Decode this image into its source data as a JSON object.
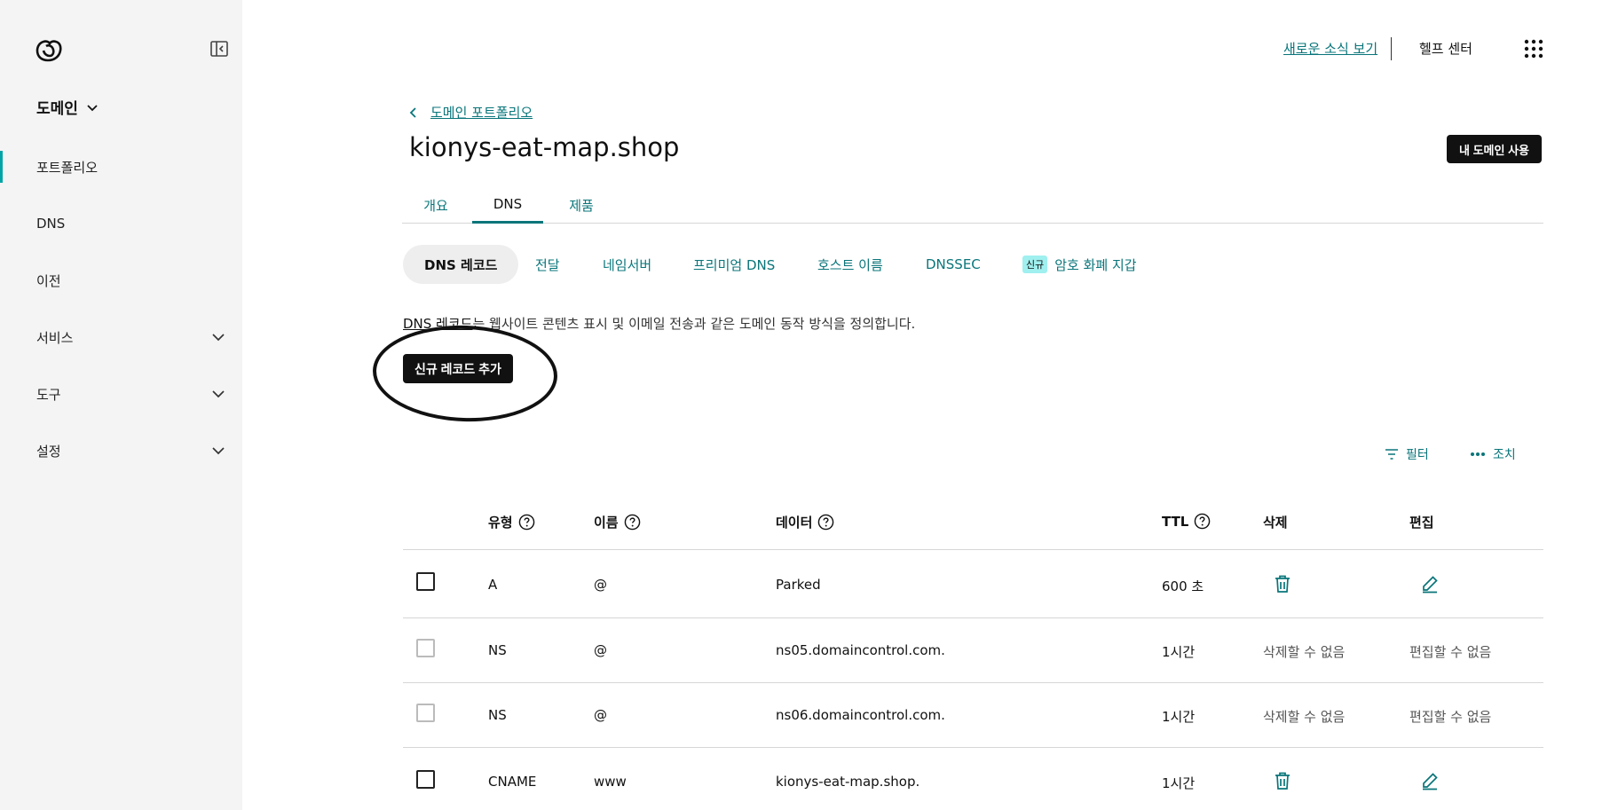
{
  "sidebar": {
    "domain_menu": "도메인",
    "items": [
      {
        "label": "포트폴리오"
      },
      {
        "label": "DNS"
      },
      {
        "label": "이전"
      },
      {
        "label": "서비스"
      },
      {
        "label": "도구"
      },
      {
        "label": "설정"
      }
    ]
  },
  "topbar": {
    "news_link": "새로운 소식 보기",
    "help_center": "헬프 센터"
  },
  "header": {
    "back_label": "도메인 포트폴리오",
    "title": "kionys-eat-map.shop",
    "use_domain_button": "내 도메인 사용"
  },
  "tabs": [
    {
      "label": "개요"
    },
    {
      "label": "DNS"
    },
    {
      "label": "제품"
    }
  ],
  "subtabs": [
    {
      "label": "DNS 레코드"
    },
    {
      "label": "전달"
    },
    {
      "label": "네임서버"
    },
    {
      "label": "프리미엄 DNS"
    },
    {
      "label": "호스트 이름"
    },
    {
      "label": "DNSSEC"
    },
    {
      "badge": "신규",
      "label": "암호 화폐 지갑"
    }
  ],
  "description": {
    "link": "DNS 레코드",
    "text": "는 웹사이트 콘텐츠 표시 및 이메일 전송과 같은 도메인 동작 방식을 정의합니다."
  },
  "add_record_button": "신규 레코드 추가",
  "toolbar": {
    "filter": "필터",
    "actions": "조치"
  },
  "table": {
    "headers": {
      "type": "유형",
      "name": "이름",
      "data": "데이터",
      "ttl": "TTL",
      "delete": "삭제",
      "edit": "편집"
    },
    "rows": [
      {
        "type": "A",
        "name": "@",
        "data": "Parked",
        "ttl": "600 초",
        "delete": "",
        "edit": ""
      },
      {
        "type": "NS",
        "name": "@",
        "data": "ns05.domaincontrol.com.",
        "ttl": "1시간",
        "delete": "삭제할 수 없음",
        "edit": "편집할 수 없음"
      },
      {
        "type": "NS",
        "name": "@",
        "data": "ns06.domaincontrol.com.",
        "ttl": "1시간",
        "delete": "삭제할 수 없음",
        "edit": "편집할 수 없음"
      },
      {
        "type": "CNAME",
        "name": "www",
        "data": "kionys-eat-map.shop.",
        "ttl": "1시간",
        "delete": "",
        "edit": ""
      }
    ]
  },
  "colors": {
    "accent": "#09757a",
    "sidebar_bg": "#f4f4f4",
    "button_bg": "#111111",
    "badge_bg": "#9ff0ef"
  }
}
